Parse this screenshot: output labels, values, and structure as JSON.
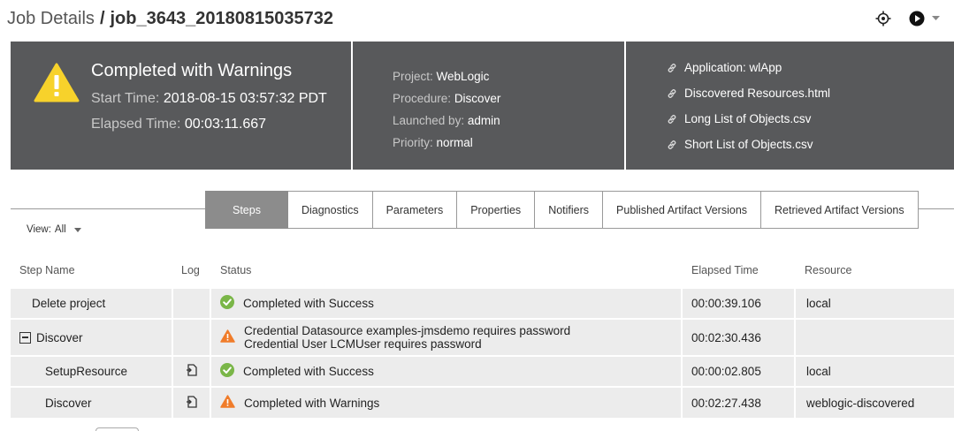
{
  "header": {
    "breadcrumb": "Job Details",
    "separator": "/",
    "job_id": "job_3643_20180815035732"
  },
  "banner": {
    "status": "Completed with Warnings",
    "start_label": "Start Time:",
    "start_value": "2018-08-15 03:57:32 PDT",
    "elapsed_label": "Elapsed Time:",
    "elapsed_value": "00:03:11.667",
    "project_label": "Project:",
    "project_value": "WebLogic",
    "procedure_label": "Procedure:",
    "procedure_value": "Discover",
    "launched_label": "Launched by:",
    "launched_value": "admin",
    "priority_label": "Priority:",
    "priority_value": "normal",
    "links": [
      {
        "label": "Application: wlApp"
      },
      {
        "label": "Discovered Resources.html"
      },
      {
        "label": "Long List of Objects.csv"
      },
      {
        "label": "Short List of Objects.csv"
      }
    ]
  },
  "tabs": [
    {
      "label": "Steps",
      "active": true
    },
    {
      "label": "Diagnostics"
    },
    {
      "label": "Parameters"
    },
    {
      "label": "Properties"
    },
    {
      "label": "Notifiers"
    },
    {
      "label": "Published Artifact Versions"
    },
    {
      "label": "Retrieved Artifact Versions"
    }
  ],
  "view": {
    "label": "View:",
    "value": "All"
  },
  "table": {
    "headers": {
      "step_name": "Step Name",
      "log": "Log",
      "status": "Status",
      "elapsed": "Elapsed Time",
      "resource": "Resource"
    },
    "rows": [
      {
        "name": "Delete project",
        "status_icon": "success-icon",
        "status": [
          "Completed with Success"
        ],
        "elapsed": "00:00:39.106",
        "resource": "local"
      },
      {
        "name": "Discover",
        "status_icon": "warning-icon",
        "status": [
          "Credential Datasource examples-jmsdemo requires password",
          "Credential User LCMUser requires password"
        ],
        "elapsed": "00:02:30.436",
        "resource": ""
      },
      {
        "name": "SetupResource",
        "status_icon": "success-icon",
        "status": [
          "Completed with Success"
        ],
        "elapsed": "00:00:02.805",
        "resource": "local"
      },
      {
        "name": "Discover",
        "status_icon": "warning-icon",
        "status": [
          "Completed with Warnings"
        ],
        "elapsed": "00:02:27.438",
        "resource": "weblogic-discovered"
      }
    ]
  },
  "colors": {
    "banner_bg": "#58595b",
    "success": "#7ab648",
    "warning": "#f07c2a",
    "warning_big": "#f7d22b",
    "active_tab": "#8c8c8c",
    "row_bg": "#ececec"
  }
}
